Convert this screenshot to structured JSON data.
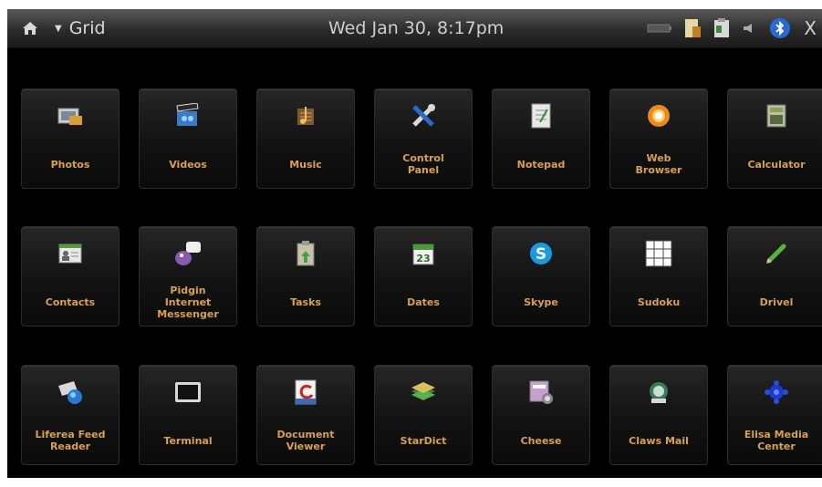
{
  "topbar": {
    "menu_label": "Grid",
    "datetime": "Wed Jan 30,  8:17pm",
    "close_label": "X"
  },
  "apps": [
    {
      "label": "Photos",
      "icon": "photos-icon"
    },
    {
      "label": "Videos",
      "icon": "videos-icon"
    },
    {
      "label": "Music",
      "icon": "music-icon"
    },
    {
      "label": "Control\nPanel",
      "icon": "tools-icon"
    },
    {
      "label": "Notepad",
      "icon": "notepad-icon"
    },
    {
      "label": "Web\nBrowser",
      "icon": "globe-icon"
    },
    {
      "label": "Calculator",
      "icon": "calculator-icon"
    },
    {
      "label": "Contacts",
      "icon": "contacts-icon"
    },
    {
      "label": "Pidgin\nInternet\nMessenger",
      "icon": "pidgin-icon"
    },
    {
      "label": "Tasks",
      "icon": "tasks-icon"
    },
    {
      "label": "Dates",
      "icon": "calendar-icon",
      "icon_text": "23"
    },
    {
      "label": "Skype",
      "icon": "skype-icon",
      "icon_text": "S"
    },
    {
      "label": "Sudoku",
      "icon": "sudoku-icon"
    },
    {
      "label": "Drivel",
      "icon": "pencil-icon"
    },
    {
      "label": "Liferea Feed\nReader",
      "icon": "feed-icon"
    },
    {
      "label": "Terminal",
      "icon": "terminal-icon"
    },
    {
      "label": "Document\nViewer",
      "icon": "document-icon"
    },
    {
      "label": "StarDict",
      "icon": "books-icon"
    },
    {
      "label": "Cheese",
      "icon": "cheese-icon"
    },
    {
      "label": "Claws Mail",
      "icon": "mail-icon"
    },
    {
      "label": "Elisa Media\nCenter",
      "icon": "media-center-icon"
    }
  ],
  "colors": {
    "label": "#d9a050",
    "topbar_text": "#d8d8d8"
  }
}
